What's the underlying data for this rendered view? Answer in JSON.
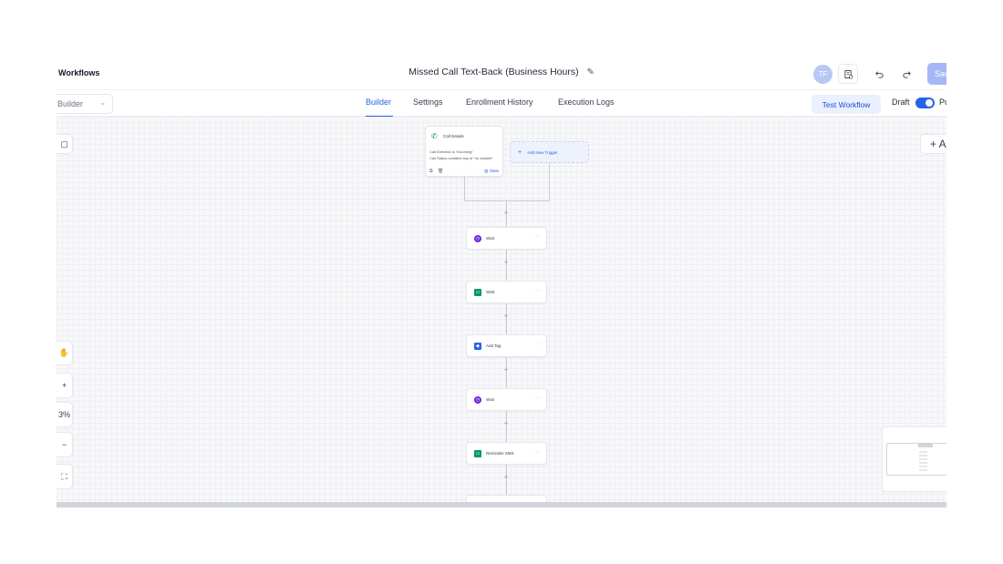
{
  "header": {
    "back_label": "o Workflows",
    "workflow_title": "Missed Call Text-Back (Business Hours)",
    "avatar_initials": "TF",
    "save_label": "Save"
  },
  "tabrow": {
    "builder_select": "Builder",
    "tabs": [
      {
        "label": "Builder",
        "active": true
      },
      {
        "label": "Settings",
        "active": false
      },
      {
        "label": "Enrollment History",
        "active": false
      },
      {
        "label": "Execution Logs",
        "active": false
      }
    ],
    "test_workflow_label": "Test Workflow",
    "draft_label": "Draft",
    "publish_label": "Pu"
  },
  "canvas": {
    "trigger": {
      "title": "Call Details",
      "conditions": [
        "Call Direction is \"incoming\"",
        "Call Status contains any of \"no answer\""
      ],
      "stats_label": "Stats"
    },
    "add_trigger_label": "Add New Trigger",
    "nodes": [
      {
        "label": "Wait",
        "icon": "clock-icon"
      },
      {
        "label": "SMS",
        "icon": "message-icon"
      },
      {
        "label": "Add Tag",
        "icon": "tag-icon"
      },
      {
        "label": "Wait",
        "icon": "clock-icon"
      },
      {
        "label": "Reminder SMS",
        "icon": "message-icon"
      }
    ],
    "zoom_level": "3%",
    "right_add_label": "+ A"
  },
  "colors": {
    "accent": "#2563eb",
    "wait_icon": "#6d28d9",
    "sms_icon": "#059669"
  }
}
